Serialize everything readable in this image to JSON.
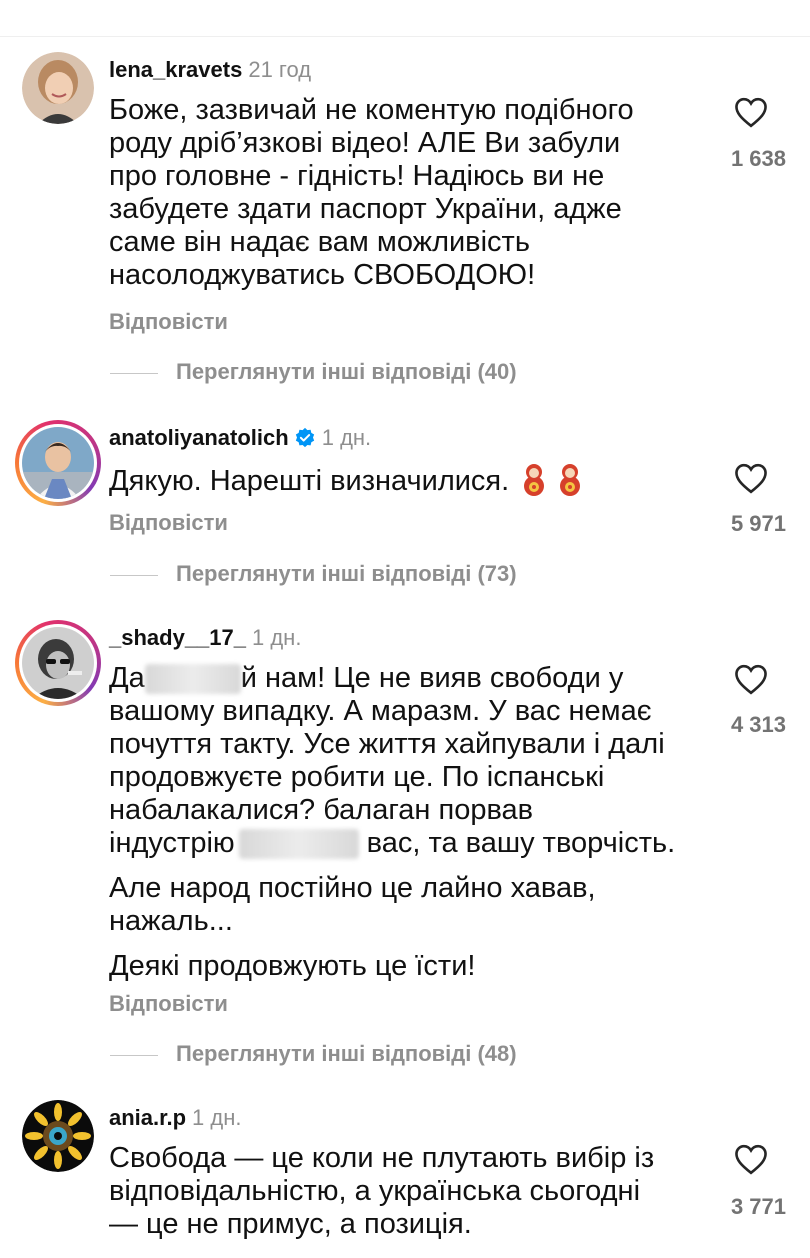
{
  "comments": [
    {
      "username": "lena_kravets",
      "time": "21 год",
      "verified": false,
      "paragraphs": [
        [
          "Боже, зазвичай не коментую подібного",
          "роду дріб’язкові відео! АЛЕ Ви забули",
          "про головне - гідність! Надіюсь ви не",
          "забудете здати паспорт України, адже",
          "саме він надає вам можливість",
          "насолоджуватись СВОБОДОЮ!"
        ]
      ],
      "reply_label": "Відповісти",
      "likes": "1 638",
      "view_more": "Переглянути інші відповіді (40)"
    },
    {
      "username": "anatoliyanatolich",
      "time": "1 дн.",
      "verified": true,
      "text": "Дякую. Нарешті визначилися.",
      "emoji": "matryoshka-doll-icon x2",
      "reply_label": "Відповісти",
      "likes": "5 971",
      "view_more": "Переглянути інші відповіді (73)"
    },
    {
      "username": "_shady__17_",
      "time": "1 дн.",
      "verified": false,
      "line1_start": "Да",
      "line1_end": "й нам! Це не вияв свободи у",
      "lines_mid": [
        "вашому випадку. А маразм. У вас немає",
        "почуття такту. Усе життя хайпували і далі",
        "продовжуєте робити це. По іспанські",
        "набалакалися? балаган порвав"
      ],
      "line_blur_start": "індустрію",
      "line_blur_end": "вас, та вашу творчість.",
      "paragraph2": [
        "Але народ постійно це лайно хавав,",
        "нажаль..."
      ],
      "paragraph3": "Деякі продовжують це їсти!",
      "reply_label": "Відповісти",
      "likes": "4 313",
      "view_more": "Переглянути інші відповіді (48)"
    },
    {
      "username": "ania.r.p",
      "time": "1 дн.",
      "verified": false,
      "lines": [
        "Свобода — це коли не плутають вибір із",
        "відповідальністю, а українська сьогодні",
        "— це не примус, а позиція."
      ],
      "likes": "3 771"
    }
  ],
  "colors": {
    "primary_text": "#111111",
    "secondary_text": "#8e8e8e",
    "verified": "#0095f6"
  }
}
